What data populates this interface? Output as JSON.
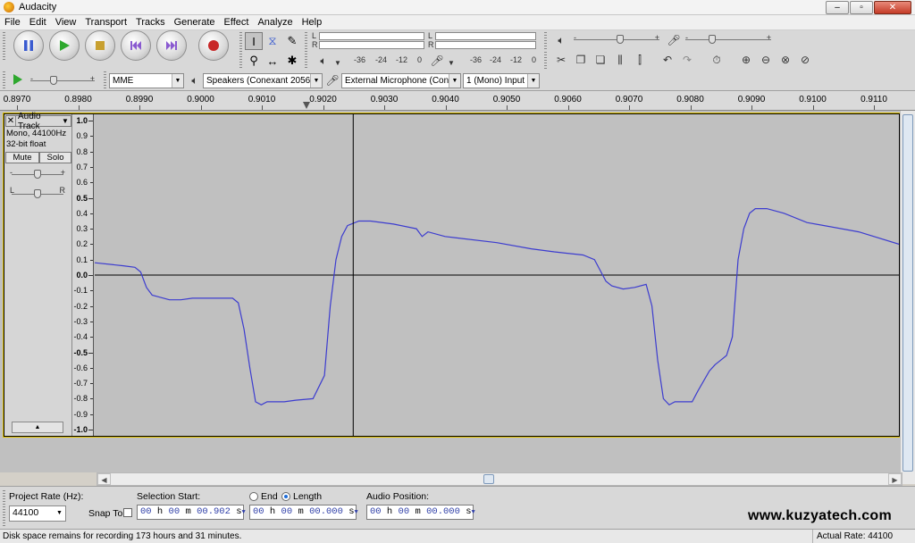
{
  "window": {
    "title": "Audacity"
  },
  "menu": [
    "File",
    "Edit",
    "View",
    "Transport",
    "Tracks",
    "Generate",
    "Effect",
    "Analyze",
    "Help"
  ],
  "meters": {
    "playback_l": "L",
    "playback_r": "R",
    "record_l": "L",
    "record_r": "R",
    "playback_scale": [
      "-36",
      "-24",
      "-12",
      "0"
    ],
    "record_scale": [
      "-36",
      "-24",
      "-12",
      "0"
    ],
    "playback_volume": 0.55,
    "record_volume": 0.3,
    "play_speed": 0.35
  },
  "devices": {
    "host": "MME",
    "output": "Speakers (Conexant 20561 Sm",
    "input": "External Microphone (Conexar",
    "channels": "1 (Mono) Input Ch"
  },
  "ruler": {
    "labels": [
      "0.8970",
      "0.8980",
      "0.8990",
      "0.9000",
      "0.9010",
      "0.9020",
      "0.9030",
      "0.9040",
      "0.9050",
      "0.9060",
      "0.9070",
      "0.9080",
      "0.9090",
      "0.9100",
      "0.9110"
    ]
  },
  "track": {
    "name": "Audio Track",
    "close_glyph": "✕",
    "format": "Mono, 44100Hz",
    "bitdepth": "32-bit float",
    "mute": "Mute",
    "solo": "Solo",
    "gain_minus": "-",
    "gain_plus": "+",
    "pan_left": "L",
    "pan_right": "R",
    "collapse": "▲",
    "vruler": [
      "1.0",
      "0.9",
      "0.8",
      "0.7",
      "0.6",
      "0.5",
      "0.4",
      "0.3",
      "0.2",
      "0.1",
      "0.0",
      "-0.1",
      "-0.2",
      "-0.3",
      "-0.4",
      "-0.5",
      "-0.6",
      "-0.7",
      "-0.8",
      "-0.9",
      "-1.0"
    ],
    "cursor_time": 0.9015,
    "waveform": {
      "time_range": [
        0.897,
        0.911
      ],
      "points": [
        [
          0.897,
          0.08
        ],
        [
          0.8975,
          0.06
        ],
        [
          0.8977,
          0.05
        ],
        [
          0.8978,
          0.02
        ],
        [
          0.8979,
          -0.08
        ],
        [
          0.898,
          -0.13
        ],
        [
          0.8981,
          -0.14
        ],
        [
          0.8983,
          -0.16
        ],
        [
          0.8985,
          -0.16
        ],
        [
          0.8987,
          -0.15
        ],
        [
          0.8988,
          -0.15
        ],
        [
          0.8994,
          -0.15
        ],
        [
          0.8995,
          -0.18
        ],
        [
          0.8996,
          -0.35
        ],
        [
          0.8997,
          -0.6
        ],
        [
          0.8998,
          -0.82
        ],
        [
          0.8999,
          -0.84
        ],
        [
          0.9,
          -0.82
        ],
        [
          0.9003,
          -0.82
        ],
        [
          0.9005,
          -0.81
        ],
        [
          0.9008,
          -0.8
        ],
        [
          0.901,
          -0.65
        ],
        [
          0.9011,
          -0.2
        ],
        [
          0.9012,
          0.1
        ],
        [
          0.9013,
          0.25
        ],
        [
          0.9014,
          0.32
        ],
        [
          0.9016,
          0.35
        ],
        [
          0.9018,
          0.35
        ],
        [
          0.9022,
          0.33
        ],
        [
          0.9026,
          0.3
        ],
        [
          0.9027,
          0.25
        ],
        [
          0.9028,
          0.28
        ],
        [
          0.9031,
          0.25
        ],
        [
          0.904,
          0.21
        ],
        [
          0.9046,
          0.17
        ],
        [
          0.905,
          0.15
        ],
        [
          0.9055,
          0.13
        ],
        [
          0.9057,
          0.1
        ],
        [
          0.9059,
          -0.04
        ],
        [
          0.906,
          -0.07
        ],
        [
          0.9062,
          -0.09
        ],
        [
          0.9064,
          -0.08
        ],
        [
          0.9066,
          -0.06
        ],
        [
          0.9067,
          -0.2
        ],
        [
          0.9068,
          -0.55
        ],
        [
          0.9069,
          -0.8
        ],
        [
          0.907,
          -0.84
        ],
        [
          0.9071,
          -0.82
        ],
        [
          0.9074,
          -0.82
        ],
        [
          0.9075,
          -0.75
        ],
        [
          0.9077,
          -0.62
        ],
        [
          0.9078,
          -0.58
        ],
        [
          0.9079,
          -0.55
        ],
        [
          0.908,
          -0.52
        ],
        [
          0.9081,
          -0.4
        ],
        [
          0.9082,
          0.1
        ],
        [
          0.9083,
          0.3
        ],
        [
          0.9084,
          0.4
        ],
        [
          0.9085,
          0.43
        ],
        [
          0.9087,
          0.43
        ],
        [
          0.909,
          0.4
        ],
        [
          0.9094,
          0.34
        ],
        [
          0.9097,
          0.32
        ],
        [
          0.9103,
          0.28
        ],
        [
          0.911,
          0.2
        ]
      ]
    }
  },
  "selection": {
    "project_rate_label": "Project Rate (Hz):",
    "project_rate": "44100",
    "snap_to": "Snap To",
    "selection_start_label": "Selection Start:",
    "end_label": "End",
    "length_label": "Length",
    "audio_position_label": "Audio Position:",
    "start_time": [
      "00",
      "h",
      "00",
      "m",
      "00.902",
      "s"
    ],
    "length_time": [
      "00",
      "h",
      "00",
      "m",
      "00.000",
      "s"
    ],
    "position_time": [
      "00",
      "h",
      "00",
      "m",
      "00.000",
      "s"
    ]
  },
  "watermark": "www.kuzyatech.com",
  "status": {
    "message": "Disk space remains for recording 173 hours and 31 minutes.",
    "actual_rate": "Actual Rate: 44100"
  },
  "colors": {
    "waveform": "#3c3ccf",
    "track_bg": "#c0c0c0",
    "timecode": "#2f3fa8"
  }
}
